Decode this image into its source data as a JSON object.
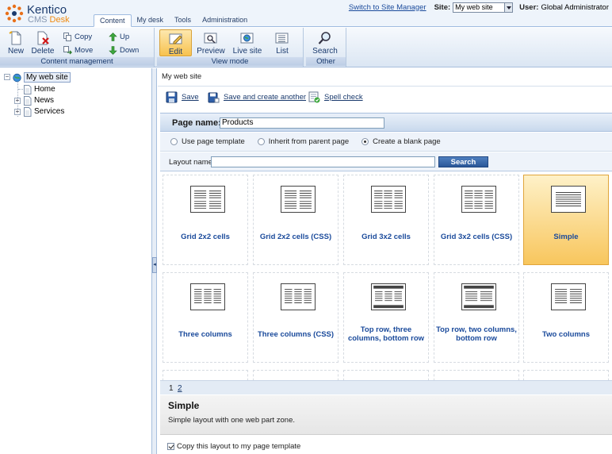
{
  "app": {
    "logo_brand": "Kentico",
    "logo_product_prefix": "CMS",
    "logo_product_name": "Desk"
  },
  "main_tabs": [
    {
      "label": "Content",
      "active": true
    },
    {
      "label": "My desk",
      "active": false
    },
    {
      "label": "Tools",
      "active": false
    },
    {
      "label": "Administration",
      "active": false
    }
  ],
  "top_right": {
    "switch_link": "Switch to Site Manager",
    "site_label": "Site:",
    "site_value": "My web site",
    "user_label": "User:",
    "user_value": "Global Administrator"
  },
  "toolbar": {
    "content_management": {
      "caption": "Content management",
      "new": "New",
      "delete": "Delete",
      "copy": "Copy",
      "move": "Move",
      "up": "Up",
      "down": "Down"
    },
    "view_mode": {
      "caption": "View mode",
      "edit": "Edit",
      "preview": "Preview",
      "live_site": "Live site",
      "list": "List"
    },
    "other": {
      "caption": "Other",
      "search": "Search"
    }
  },
  "tree": {
    "root": "My web site",
    "children": [
      "Home",
      "News",
      "Services"
    ]
  },
  "content": {
    "breadcrumb": "My web site",
    "actions": {
      "save": "Save",
      "save_another": "Save and create another",
      "spell_check": "Spell check"
    },
    "page_name_label": "Page name:",
    "page_name_value": "Products",
    "radios": [
      {
        "label": "Use page template",
        "checked": false
      },
      {
        "label": "Inherit from parent page",
        "checked": false
      },
      {
        "label": "Create a blank page",
        "checked": true
      }
    ],
    "layout_name_label": "Layout name:",
    "layout_name_value": "",
    "search_button": "Search",
    "layouts": [
      {
        "name": "Grid 2x2 cells",
        "selected": false
      },
      {
        "name": "Grid 2x2 cells (CSS)",
        "selected": false
      },
      {
        "name": "Grid 3x2 cells",
        "selected": false
      },
      {
        "name": "Grid 3x2 cells (CSS)",
        "selected": false
      },
      {
        "name": "Simple",
        "selected": true
      },
      {
        "name": "Three columns",
        "selected": false
      },
      {
        "name": "Three columns (CSS)",
        "selected": false
      },
      {
        "name": "Top row, three columns, bottom row",
        "selected": false
      },
      {
        "name": "Top row, two columns, bottom row",
        "selected": false
      },
      {
        "name": "Two columns",
        "selected": false
      }
    ],
    "pager": {
      "page1": "1",
      "page2": "2"
    },
    "selected_title": "Simple",
    "selected_description": "Simple layout with one web part zone.",
    "copy_checkbox_label": "Copy this layout to my page template",
    "copy_checked": true
  }
}
